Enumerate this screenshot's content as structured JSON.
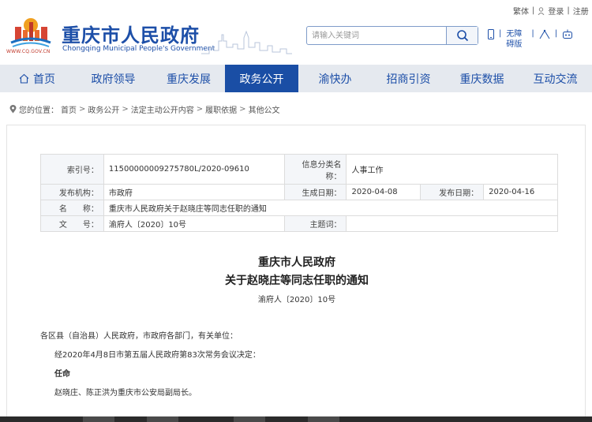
{
  "header": {
    "site_title": "重庆市人民政府",
    "site_subtitle": "Chongqing Municipal People's Government",
    "logo_url": "WWW.CQ.GOV.CN",
    "search_placeholder": "请输入关键词",
    "top_links": [
      "繁体",
      "|",
      "登录",
      "|",
      "注册"
    ],
    "util": {
      "accessibility_label": "无障碍版"
    }
  },
  "nav": {
    "items": [
      "首页",
      "政府领导",
      "重庆发展",
      "政务公开",
      "渝快办",
      "招商引资",
      "重庆数据",
      "互动交流"
    ],
    "active_index": 3
  },
  "breadcrumb": {
    "prefix": "您的位置：",
    "items": [
      "首页",
      "政务公开",
      "法定主动公开内容",
      "履职依据",
      "其他公文"
    ],
    "separator": ">"
  },
  "meta": {
    "index_label": "索引号：",
    "index_value": "11500000009275780L/2020-09610",
    "category_label": "信息分类名称：",
    "category_value": "人事工作",
    "issuer_label": "发布机构：",
    "issuer_value": "市政府",
    "created_label": "生成日期：",
    "created_value": "2020-04-08",
    "published_label": "发布日期：",
    "published_value": "2020-04-16",
    "name_label": "名　　称：",
    "name_value": "重庆市人民政府关于赵晓庄等同志任职的通知",
    "docnum_label": "文　　号：",
    "docnum_value": "渝府人〔2020〕10号",
    "subject_label": "主题词：",
    "subject_value": ""
  },
  "document": {
    "title_line1": "重庆市人民政府",
    "title_line2": "关于赵晓庄等同志任职的通知",
    "doc_number": "渝府人〔2020〕10号",
    "salutation": "各区县（自治县）人民政府，市政府各部门，有关单位：",
    "para1": "经2020年4月8日市第五届人民政府第83次常务会议决定：",
    "heading": "任命",
    "para2": "赵晓庄、陈正洪为重庆市公安局副局长。"
  },
  "colors": {
    "brand_blue": "#1d4fa8",
    "nav_active": "#1a4ea5",
    "nav_bg": "#e5e9ef",
    "logo_red": "#c0392b",
    "logo_orange": "#f0a020"
  }
}
